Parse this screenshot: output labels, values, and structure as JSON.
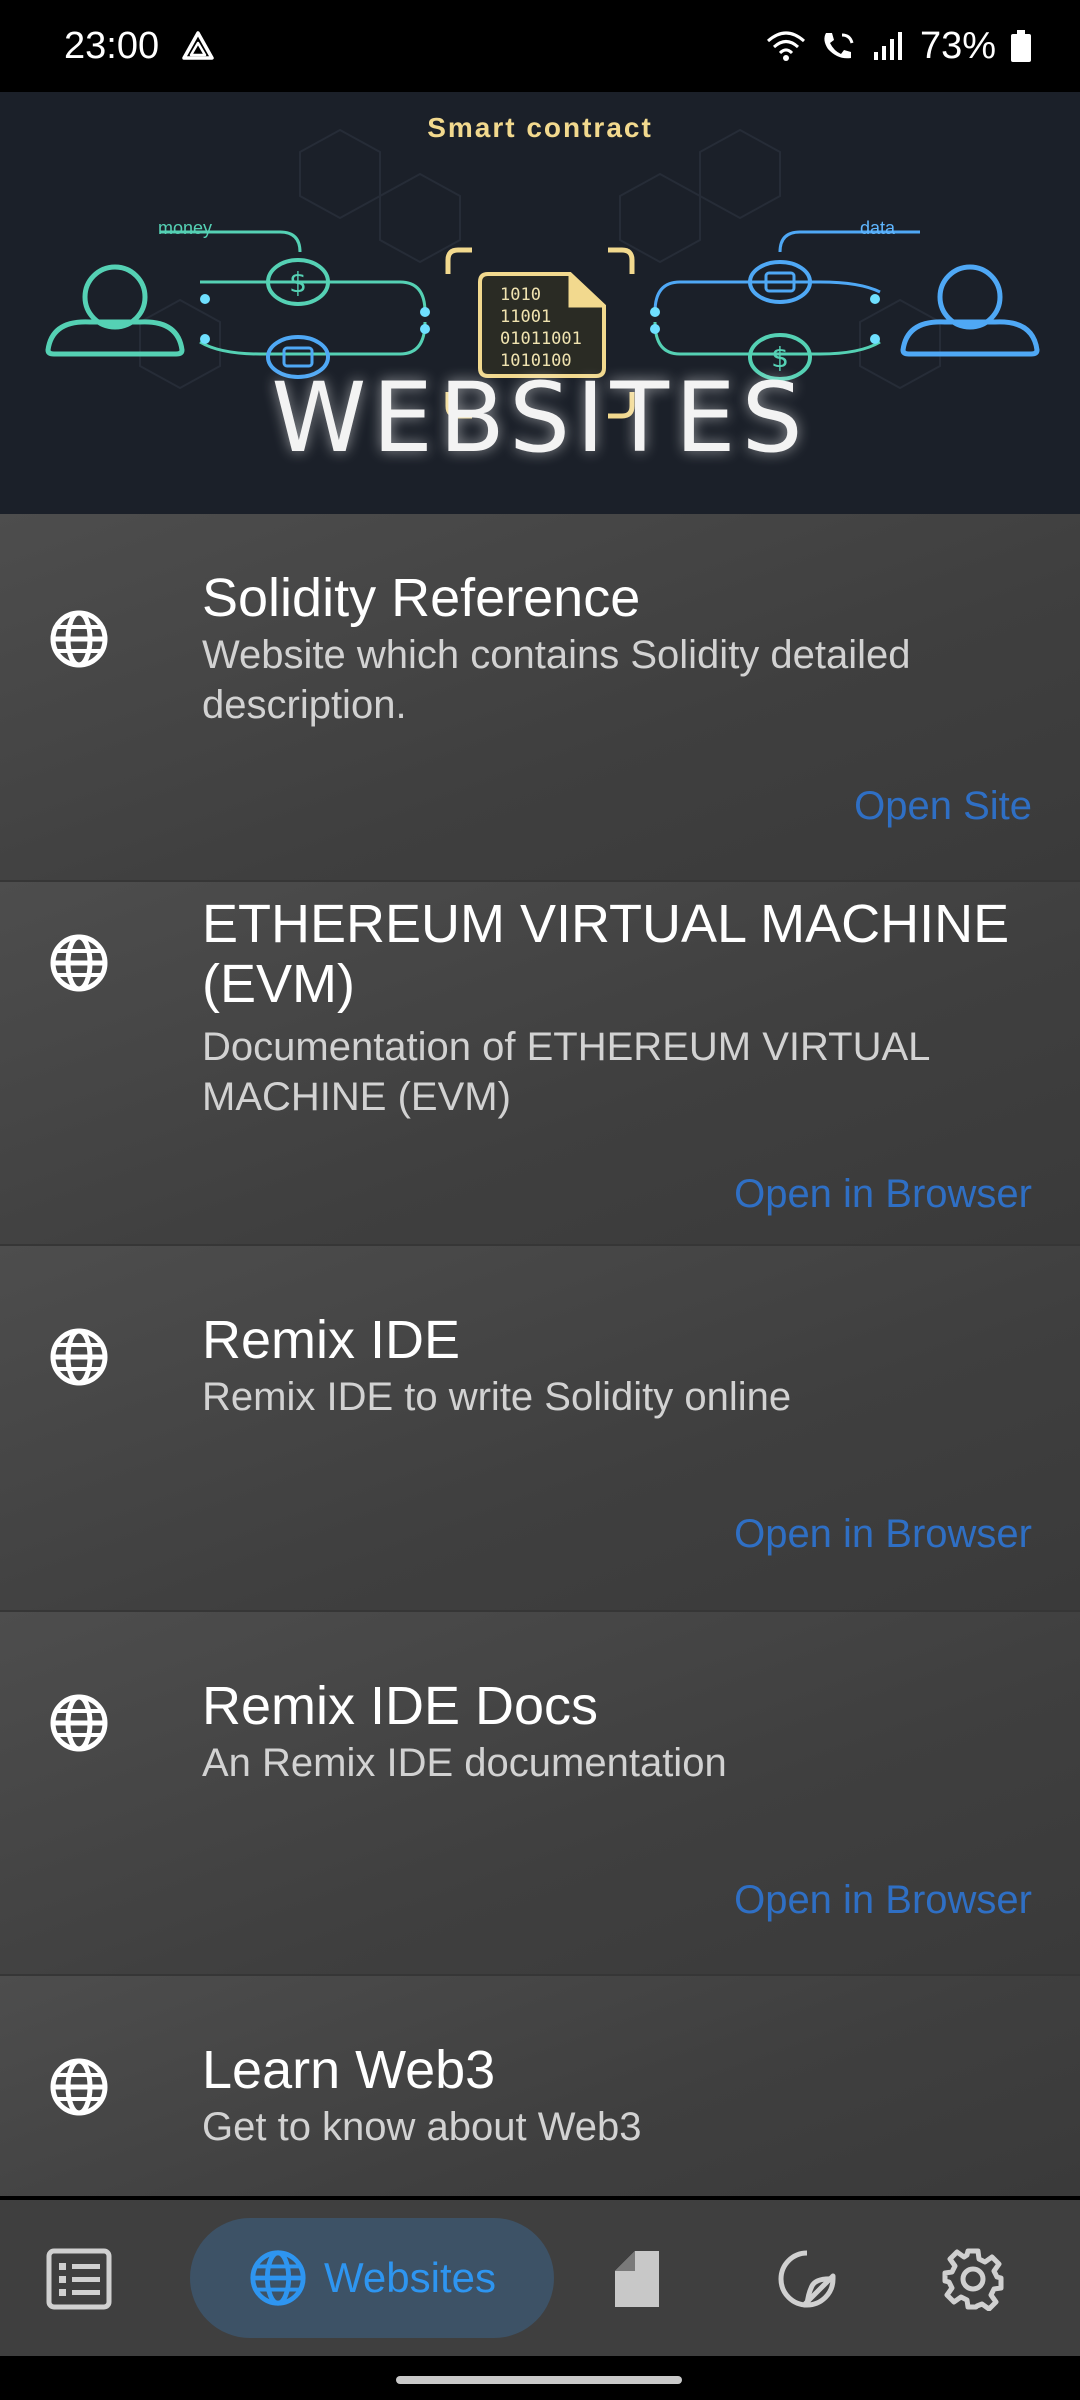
{
  "status_bar": {
    "time": "23:00",
    "battery": "73%",
    "icons": [
      "alert-triangle-icon",
      "wifi-icon",
      "wifi-calling-icon",
      "signal-icon",
      "battery-icon"
    ]
  },
  "banner": {
    "subtitle": "Smart contract",
    "title": "WEBSITES",
    "money_label": "money",
    "data_label": "data",
    "binary_lines": [
      "1010",
      "11001",
      "01011001",
      "1010100"
    ]
  },
  "websites": [
    {
      "title": "Solidity Reference",
      "description": "Website which contains Solidity detailed description.",
      "action": "Open Site"
    },
    {
      "title": "ETHEREUM VIRTUAL MACHINE (EVM)",
      "description": "Documentation of ETHEREUM VIRTUAL MACHINE (EVM)",
      "action": "Open in Browser"
    },
    {
      "title": "Remix IDE",
      "description": "Remix IDE to write Solidity online",
      "action": "Open in Browser"
    },
    {
      "title": "Remix IDE Docs",
      "description": "An Remix IDE documentation",
      "action": "Open in Browser"
    },
    {
      "title": "Learn Web3",
      "description": "Get to know about Web3",
      "action": ""
    }
  ],
  "bottom_nav": {
    "items": [
      {
        "icon": "list-icon",
        "label": ""
      },
      {
        "icon": "globe-icon",
        "label": "Websites",
        "active": true
      },
      {
        "icon": "document-icon",
        "label": ""
      },
      {
        "icon": "sticker-icon",
        "label": ""
      },
      {
        "icon": "gear-icon",
        "label": ""
      }
    ]
  },
  "colors": {
    "accent": "#2e95f0",
    "link": "#2f6fc4",
    "card_bg": "#474747",
    "nav_bg": "#3f3f3f",
    "pill_bg": "#3d5266"
  }
}
